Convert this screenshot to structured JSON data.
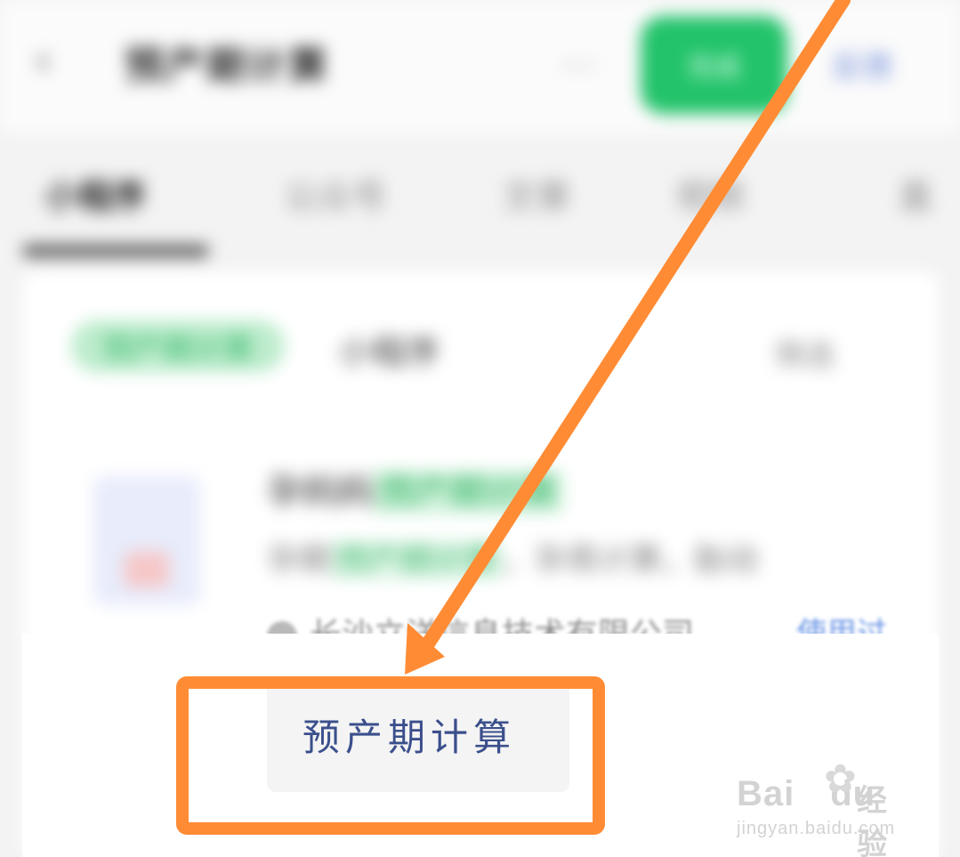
{
  "background_app": {
    "back_icon": "‹",
    "title": "预产期计算",
    "menu_icon": "…",
    "green_button_label": "完成",
    "top_right_link": "反馈",
    "tabs": [
      {
        "label": "小程序 "
      },
      {
        "label": "公众号"
      },
      {
        "label": "文章"
      },
      {
        "label": "视频"
      },
      {
        "label": "直"
      }
    ],
    "filter_chip_green": "预产期计算",
    "filter_chip_gray": "小程序",
    "right_label": "筛选",
    "result": {
      "line1_prefix": "孕妈妈",
      "line1_highlight": "预产期计算",
      "line2_prefix": "孕期",
      "line2_highlight": "预产期计算",
      "line2_suffix": "，孕周计算，胎动",
      "company": "长沙立洋信息技术有限公司",
      "used_badge": "使用过"
    }
  },
  "suggestion": {
    "text": "预产期计算"
  },
  "watermark": {
    "main": "Bai",
    "paw_icon": "paw-icon",
    "du": "du",
    "cn": "经验",
    "url": "jingyan.baidu.com"
  },
  "colors": {
    "annotation_orange": "#ff8c35",
    "green": "#22c36a",
    "suggestion_text": "#3b4f8c"
  }
}
